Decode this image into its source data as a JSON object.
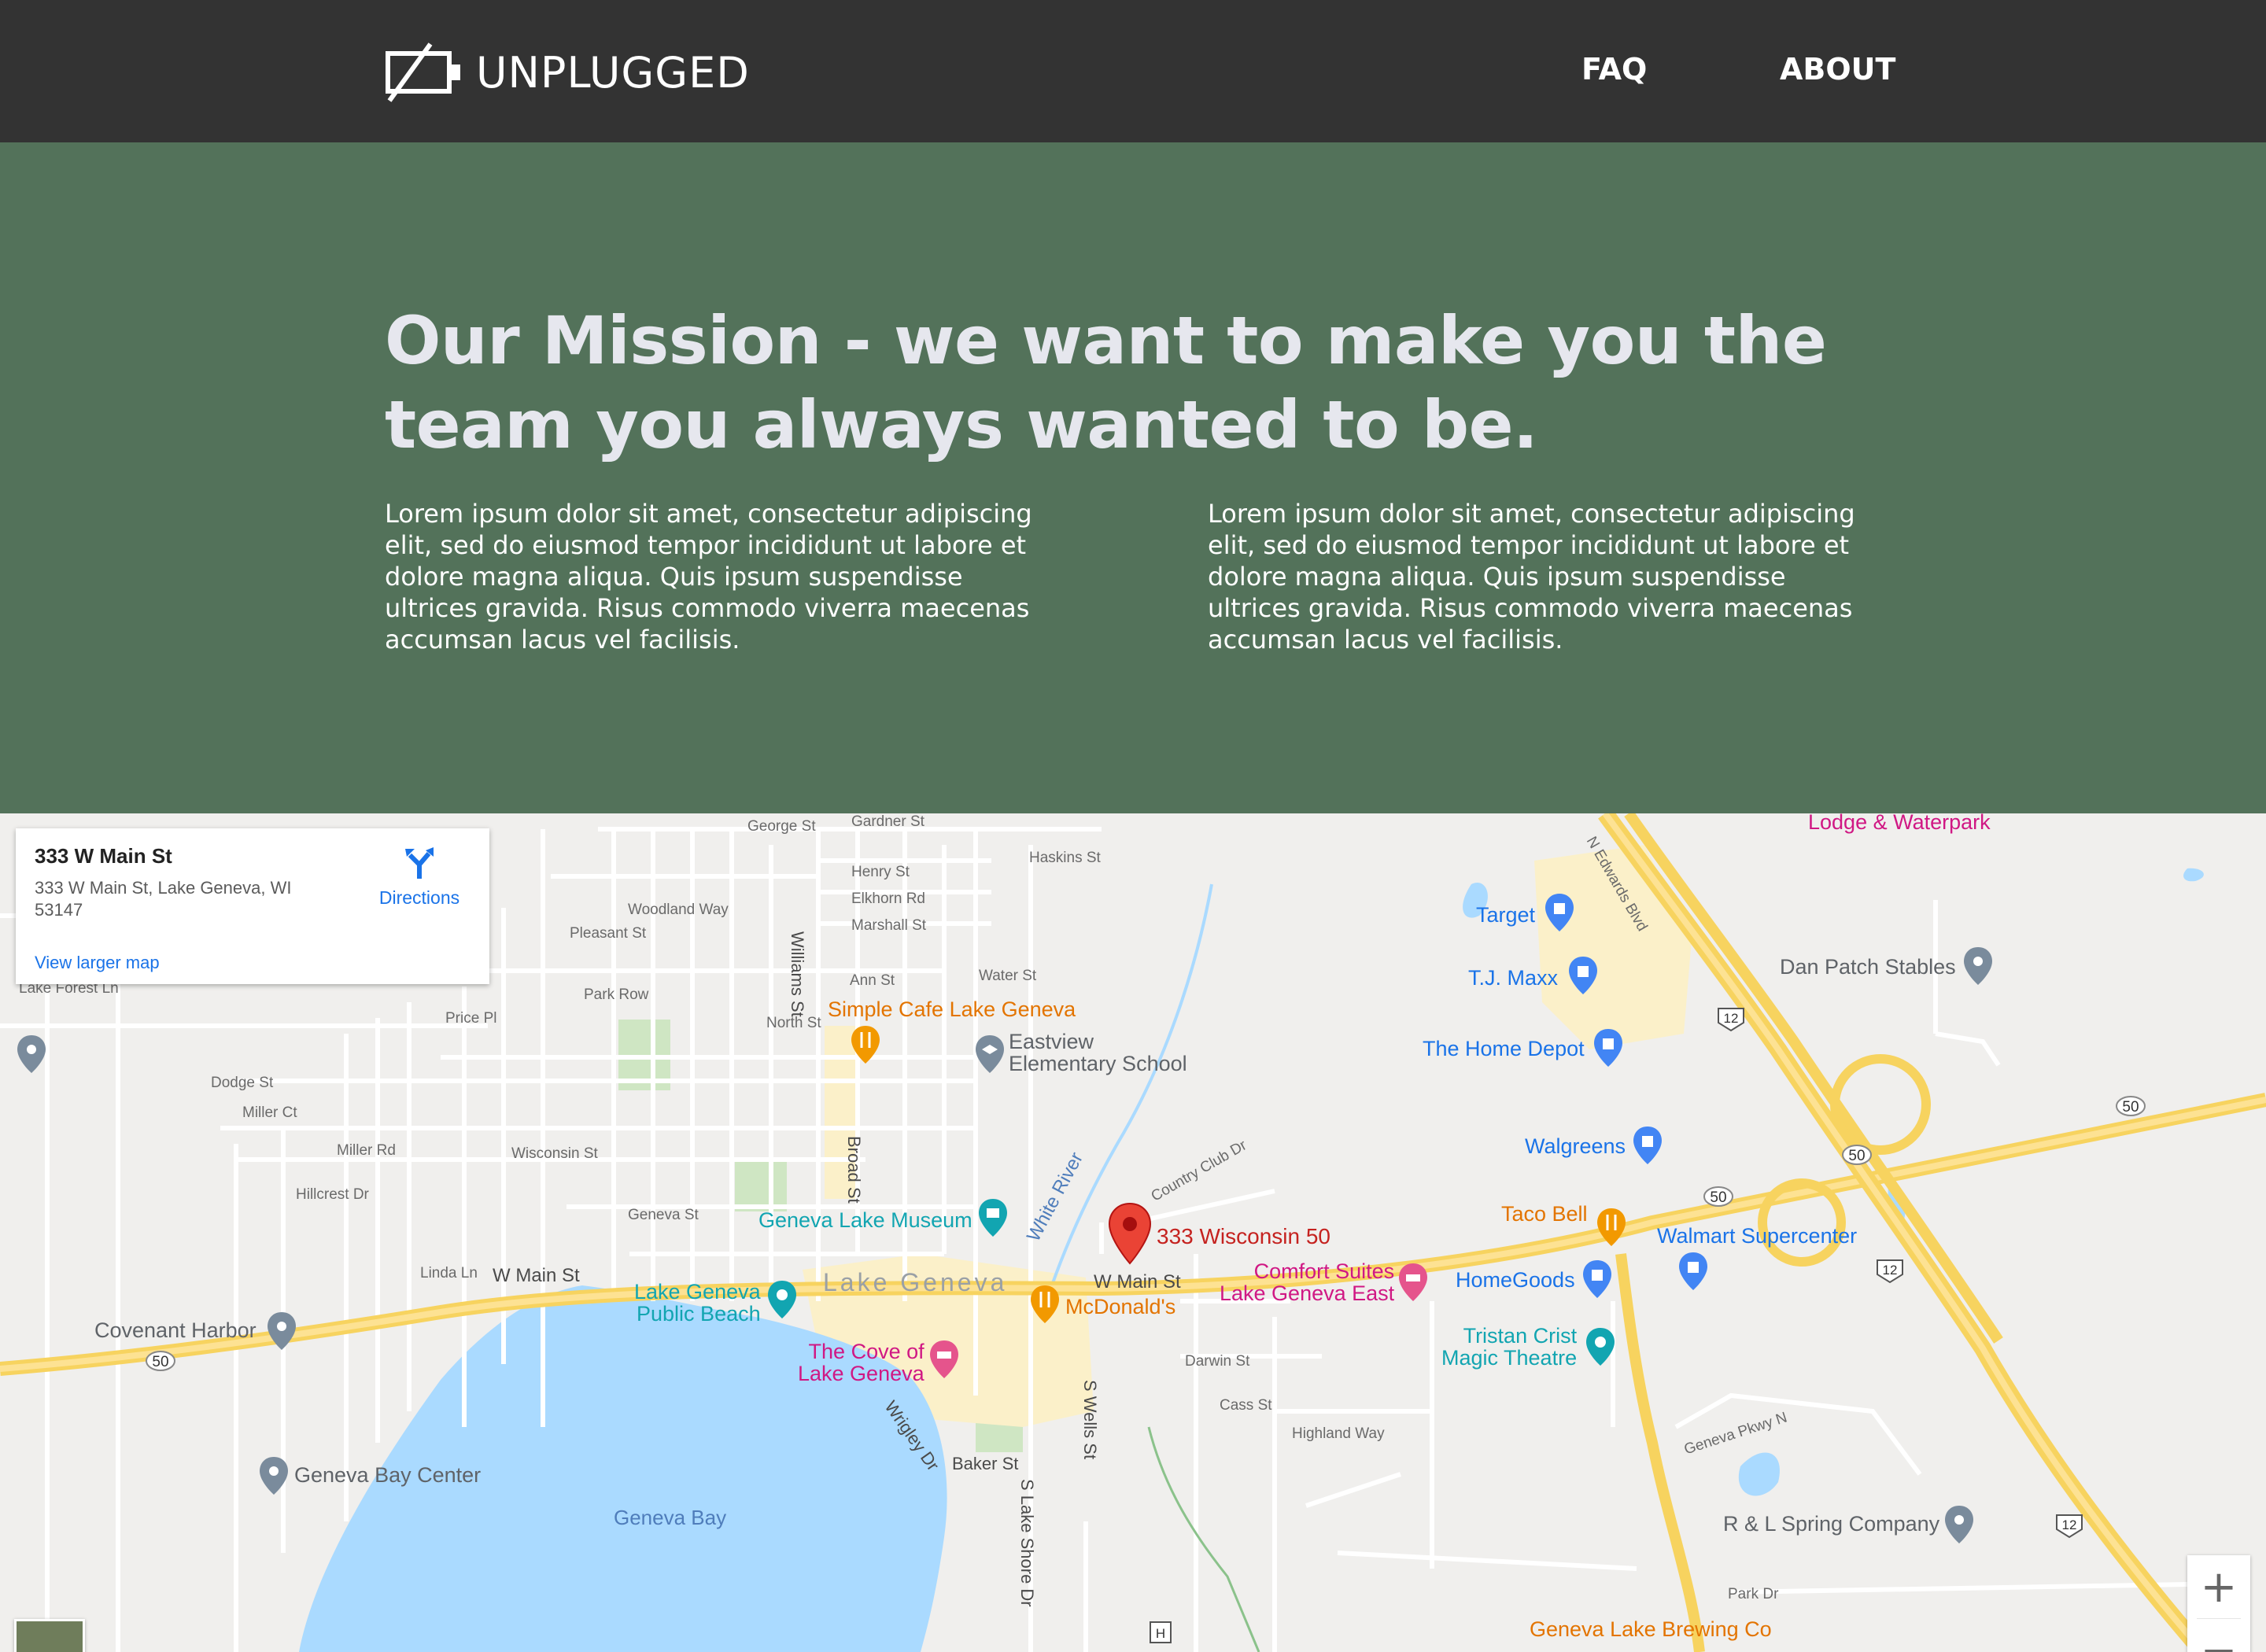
{
  "header": {
    "brand": "UNPLUGGED",
    "nav": [
      {
        "label": "FAQ"
      },
      {
        "label": "ABOUT"
      }
    ]
  },
  "mission": {
    "title": "Our Mission - we want to make you the team you always wanted to be.",
    "columns": [
      "Lorem ipsum dolor sit amet, consectetur adipiscing elit, sed do eiusmod tempor incididunt ut labore et dolore magna aliqua. Quis ipsum suspendisse ultrices gravida. Risus commodo viverra maecenas accumsan lacus vel facilisis.",
      "Lorem ipsum dolor sit amet, consectetur adipiscing elit, sed do eiusmod tempor incididunt ut labore et dolore magna aliqua. Quis ipsum suspendisse ultrices gravida. Risus commodo viverra maecenas accumsan lacus vel facilisis."
    ]
  },
  "map": {
    "info": {
      "name": "333 W Main St",
      "address": "333 W Main St, Lake Geneva, WI 53147",
      "directions": "Directions",
      "larger_map": "View larger map"
    },
    "marker_label": "333 Wisconsin 50",
    "town": "Lake Geneva",
    "bay": "Geneva Bay",
    "places": {
      "lodge": "Lodge & Waterpark",
      "target": "Target",
      "tjmaxx": "T.J. Maxx",
      "homedepot": "The Home Depot",
      "danpatch": "Dan Patch Stables",
      "walgreens": "Walgreens",
      "tacobell": "Taco Bell",
      "walmart": "Walmart Supercenter",
      "homegoods": "HomeGoods",
      "tristan": "Tristan Crist\nMagic Theatre",
      "comfort": "Comfort Suites\nLake Geneva East",
      "mcdonalds": "McDonald's",
      "simplecafe": "Simple Cafe Lake Geneva",
      "eastview": "Eastview\nElementary School",
      "museum": "Geneva Lake Museum",
      "beach": "Lake Geneva\nPublic Beach",
      "cove": "The Cove of\nLake Geneva",
      "covenant": "Covenant Harbor",
      "baycenter": "Geneva Bay Center",
      "rlspring": "R & L Spring Company",
      "brewing": "Geneva Lake Brewing Co"
    },
    "streets": {
      "georgest": "George St",
      "gardnerst": "Gardner St",
      "haskinsst": "Haskins St",
      "henryst": "Henry St",
      "elkhornrd": "Elkhorn Rd",
      "marshallst": "Marshall St",
      "woodlandway": "Woodland Way",
      "pleasantst": "Pleasant St",
      "annst": "Ann St",
      "waterst": "Water St",
      "parkrow": "Park Row",
      "pricepl": "Price Pl",
      "northst": "North St",
      "dodgest": "Dodge St",
      "millerct": "Miller Ct",
      "millerrd": "Miller Rd",
      "hillcrestdr": "Hillcrest Dr",
      "wisconsinst": "Wisconsin St",
      "genevast": "Geneva St",
      "lindaln": "Linda Ln",
      "wmainst": "W Main St",
      "wmainst2": "W Main St",
      "darwinst": "Darwin St",
      "cassst": "Cass St",
      "highlandway": "Highland Way",
      "bakerst": "Baker St",
      "lakeforestln": "Lake Forest Ln",
      "parkdr": "Park Dr",
      "genevapkwyn": "Geneva Pkwy N",
      "williamsst": "Williams St",
      "broadst": "Broad St",
      "whiteriver": "White River",
      "wrigleydr": "Wrigley Dr",
      "swellsst": "S Wells St",
      "slakeshoredr": "S Lake Shore Dr",
      "countryclubdr": "Country Club Dr",
      "nedwardsblvd": "N Edwards Blvd"
    },
    "shields": {
      "r50": "50",
      "r12": "12",
      "h": "H"
    },
    "zoom": {
      "in": "+",
      "out": "−"
    }
  }
}
